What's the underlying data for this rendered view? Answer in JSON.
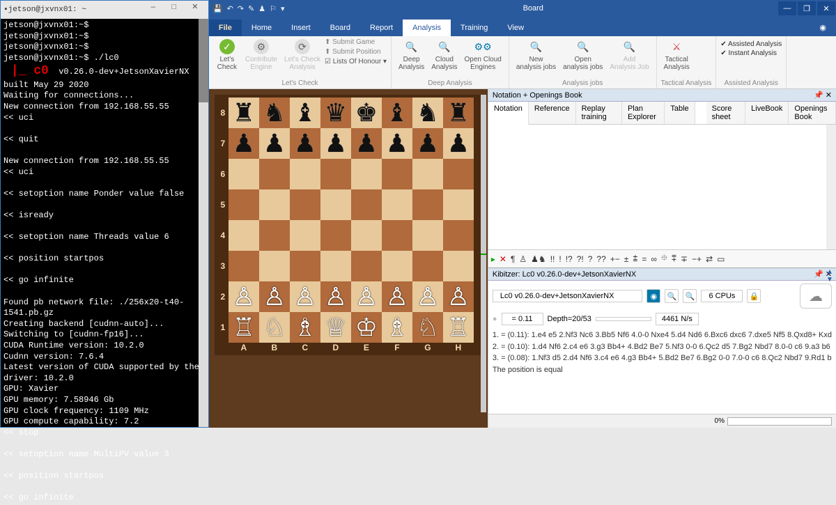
{
  "terminal": {
    "title": "jetson@jxvnx01: ~",
    "lines": "jetson@jxvnx01:~$\njetson@jxvnx01:~$\njetson@jxvnx01:~$\njetson@jxvnx01:~$ ./lc0\n",
    "banner_logo": " |_ c0",
    "banner": "  v0.26.0-dev+JetsonXavierNX built May 29 2020",
    "body": "Waiting for connections...\nNew connection from 192.168.55.55\n<< uci\n\n<< quit\n\nNew connection from 192.168.55.55\n<< uci\n\n<< setoption name Ponder value false\n\n<< isready\n\n<< setoption name Threads value 6\n\n<< position startpos\n\n<< go infinite\n\nFound pb network file: ./256x20-t40-1541.pb.gz\nCreating backend [cudnn-auto]...\nSwitching to [cudnn-fp16]...\nCUDA Runtime version: 10.2.0\nCudnn version: 7.6.4\nLatest version of CUDA supported by the driver: 10.2.0\nGPU: Xavier\nGPU memory: 7.58946 Gb\nGPU clock frequency: 1109 MHz\nGPU compute capability: 7.2\n<< stop\n\n<< setoption name MultiPV value 3\n\n<< position startpos\n\n<< go infinite"
  },
  "app": {
    "title": "Board",
    "menutabs": [
      "File",
      "Home",
      "Insert",
      "Board",
      "Report",
      "Analysis",
      "Training",
      "View"
    ],
    "active_tab": "Analysis",
    "ribbon": {
      "lets_check": {
        "btn": "Let's\nCheck",
        "contrib": "Contribute\nEngine",
        "lc_analysis": "Let's Check\nAnalysis",
        "submit_game": "Submit Game",
        "submit_position": "Submit Position",
        "lists": "Lists Of Honour",
        "label": "Let's Check"
      },
      "deep": {
        "deep": "Deep\nAnalysis",
        "cloud": "Cloud\nAnalysis",
        "open_cloud": "Open Cloud\nEngines",
        "label": "Deep Analysis"
      },
      "jobs": {
        "new": "New\nanalysis jobs",
        "open": "Open\nanalysis jobs",
        "add": "Add\nAnalysis Job",
        "label": "Analysis jobs"
      },
      "tactical": {
        "btn": "Tactical\nAnalysis",
        "label": "Tactical Analysis"
      },
      "assisted": {
        "chk1": "Assisted Analysis",
        "chk2": "Instant Analysis",
        "label": "Assisted Analysis"
      }
    }
  },
  "notation": {
    "header": "Notation + Openings Book",
    "tabs": [
      "Notation",
      "Reference",
      "Replay training",
      "Plan Explorer",
      "Table",
      "Score sheet",
      "LiveBook",
      "Openings Book"
    ]
  },
  "kibitzer": {
    "header": "Kibitzer: Lc0 v0.26.0-dev+JetsonXavierNX",
    "engine": "Lc0 v0.26.0-dev+JetsonXavierNX",
    "cpus": "6 CPUs",
    "eval": "= 0.11",
    "depth": "Depth=20/53",
    "nps": "4461 N/s",
    "line1": "1. = (0.11): 1.e4 e5 2.Nf3 Nc6 3.Bb5 Nf6 4.0-0 Nxe4 5.d4 Nd6 6.Bxc6 dxc6 7.dxe5 Nf5 8.Qxd8+ Kxd",
    "line2": "2. = (0.10): 1.d4 Nf6 2.c4 e6 3.g3 Bb4+ 4.Bd2 Be7 5.Nf3 0-0 6.Qc2 d5 7.Bg2 Nbd7 8.0-0 c6 9.a3 b6",
    "line3": "3. = (0.08): 1.Nf3 d5 2.d4 Nf6 3.c4 e6 4.g3 Bb4+ 5.Bd2 Be7 6.Bg2 0-0 7.0-0 c6 8.Qc2 Nbd7 9.Rd1 b",
    "summary": "The position is equal"
  },
  "status": {
    "pct": "0%"
  },
  "files": [
    "A",
    "B",
    "C",
    "D",
    "E",
    "F",
    "G",
    "H"
  ],
  "ranks": [
    "8",
    "7",
    "6",
    "5",
    "4",
    "3",
    "2",
    "1"
  ]
}
